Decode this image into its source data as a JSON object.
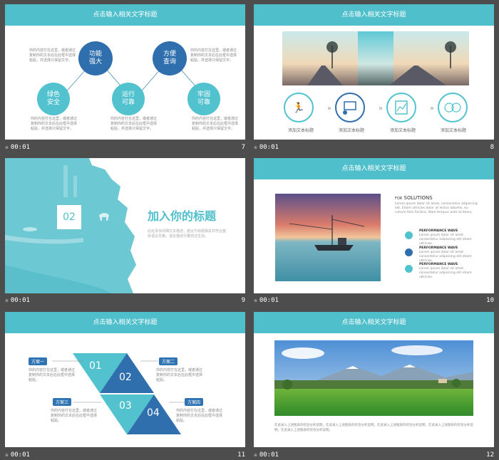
{
  "slides": [
    {
      "title": "点击输入相关文字标题",
      "time": "00:01",
      "number": "7",
      "nodes": [
        "功能\n强大",
        "方便\n查询",
        "绿色\n安全",
        "运行\n可靠",
        "牢固\n可靠"
      ],
      "desc": "你的内容打在这里，或者通过复制你的文本后在此框中选择粘贴，并选择只保留文字。"
    },
    {
      "title": "点击输入相关文字标题",
      "time": "00:01",
      "number": "8",
      "steps": [
        "添加文本标题",
        "添加文本标题",
        "添加文本标题",
        "添加文本标题"
      ]
    },
    {
      "time": "00:01",
      "number": "9",
      "badge": "02",
      "heading": "加入你的标题",
      "body": "此处添加详细文本描述，建议与标题相关并符合整体语言风格，语言描述尽量简洁生动。"
    },
    {
      "title": "点击输入相关文字标题",
      "time": "00:01",
      "number": "10",
      "for_label": "FOR",
      "solutions_label": "SOLUTIONS",
      "intro": "Lorem ipsum dolor sit amet, consectetur adipiscing elit. Etiam ultricies dolor ut lectus lobortis, eu rutrum felis facilisis. Nam tempus ante at libero.",
      "items": [
        {
          "title": "PERFORMANCE WAVE",
          "text": "Lorem ipsum dolor sit amet consectetur adipiscing elit etiam ultricies."
        },
        {
          "title": "PERFORMANCE WAVE",
          "text": "Lorem ipsum dolor sit amet consectetur adipiscing elit etiam ultricies."
        },
        {
          "title": "PERFORMANCE WAVE",
          "text": "Lorem ipsum dolor sit amet consectetur adipiscing elit etiam ultricies."
        }
      ]
    },
    {
      "title": "点击输入相关文字标题",
      "time": "00:01",
      "number": "11",
      "tags": [
        "方案一",
        "方案二",
        "方案三",
        "方案四"
      ],
      "nums": [
        "01",
        "02",
        "03",
        "04"
      ],
      "desc": "你的内容打在这里，或者通过复制你的文本后在此框中选择粘贴。"
    },
    {
      "title": "点击输入相关文字标题",
      "time": "00:01",
      "number": "12",
      "body": "在此录入上述图表的综合分析说明，在此录入上述图表的综合分析说明。在此录入上述图表的综合分析说明，在此录入上述图表的综合分析说明。在此录入上述图表的综合分析说明。"
    }
  ],
  "colors": {
    "teal": "#4fbfcb",
    "navy": "#2f6fae",
    "bg": "#4d4d4d"
  }
}
